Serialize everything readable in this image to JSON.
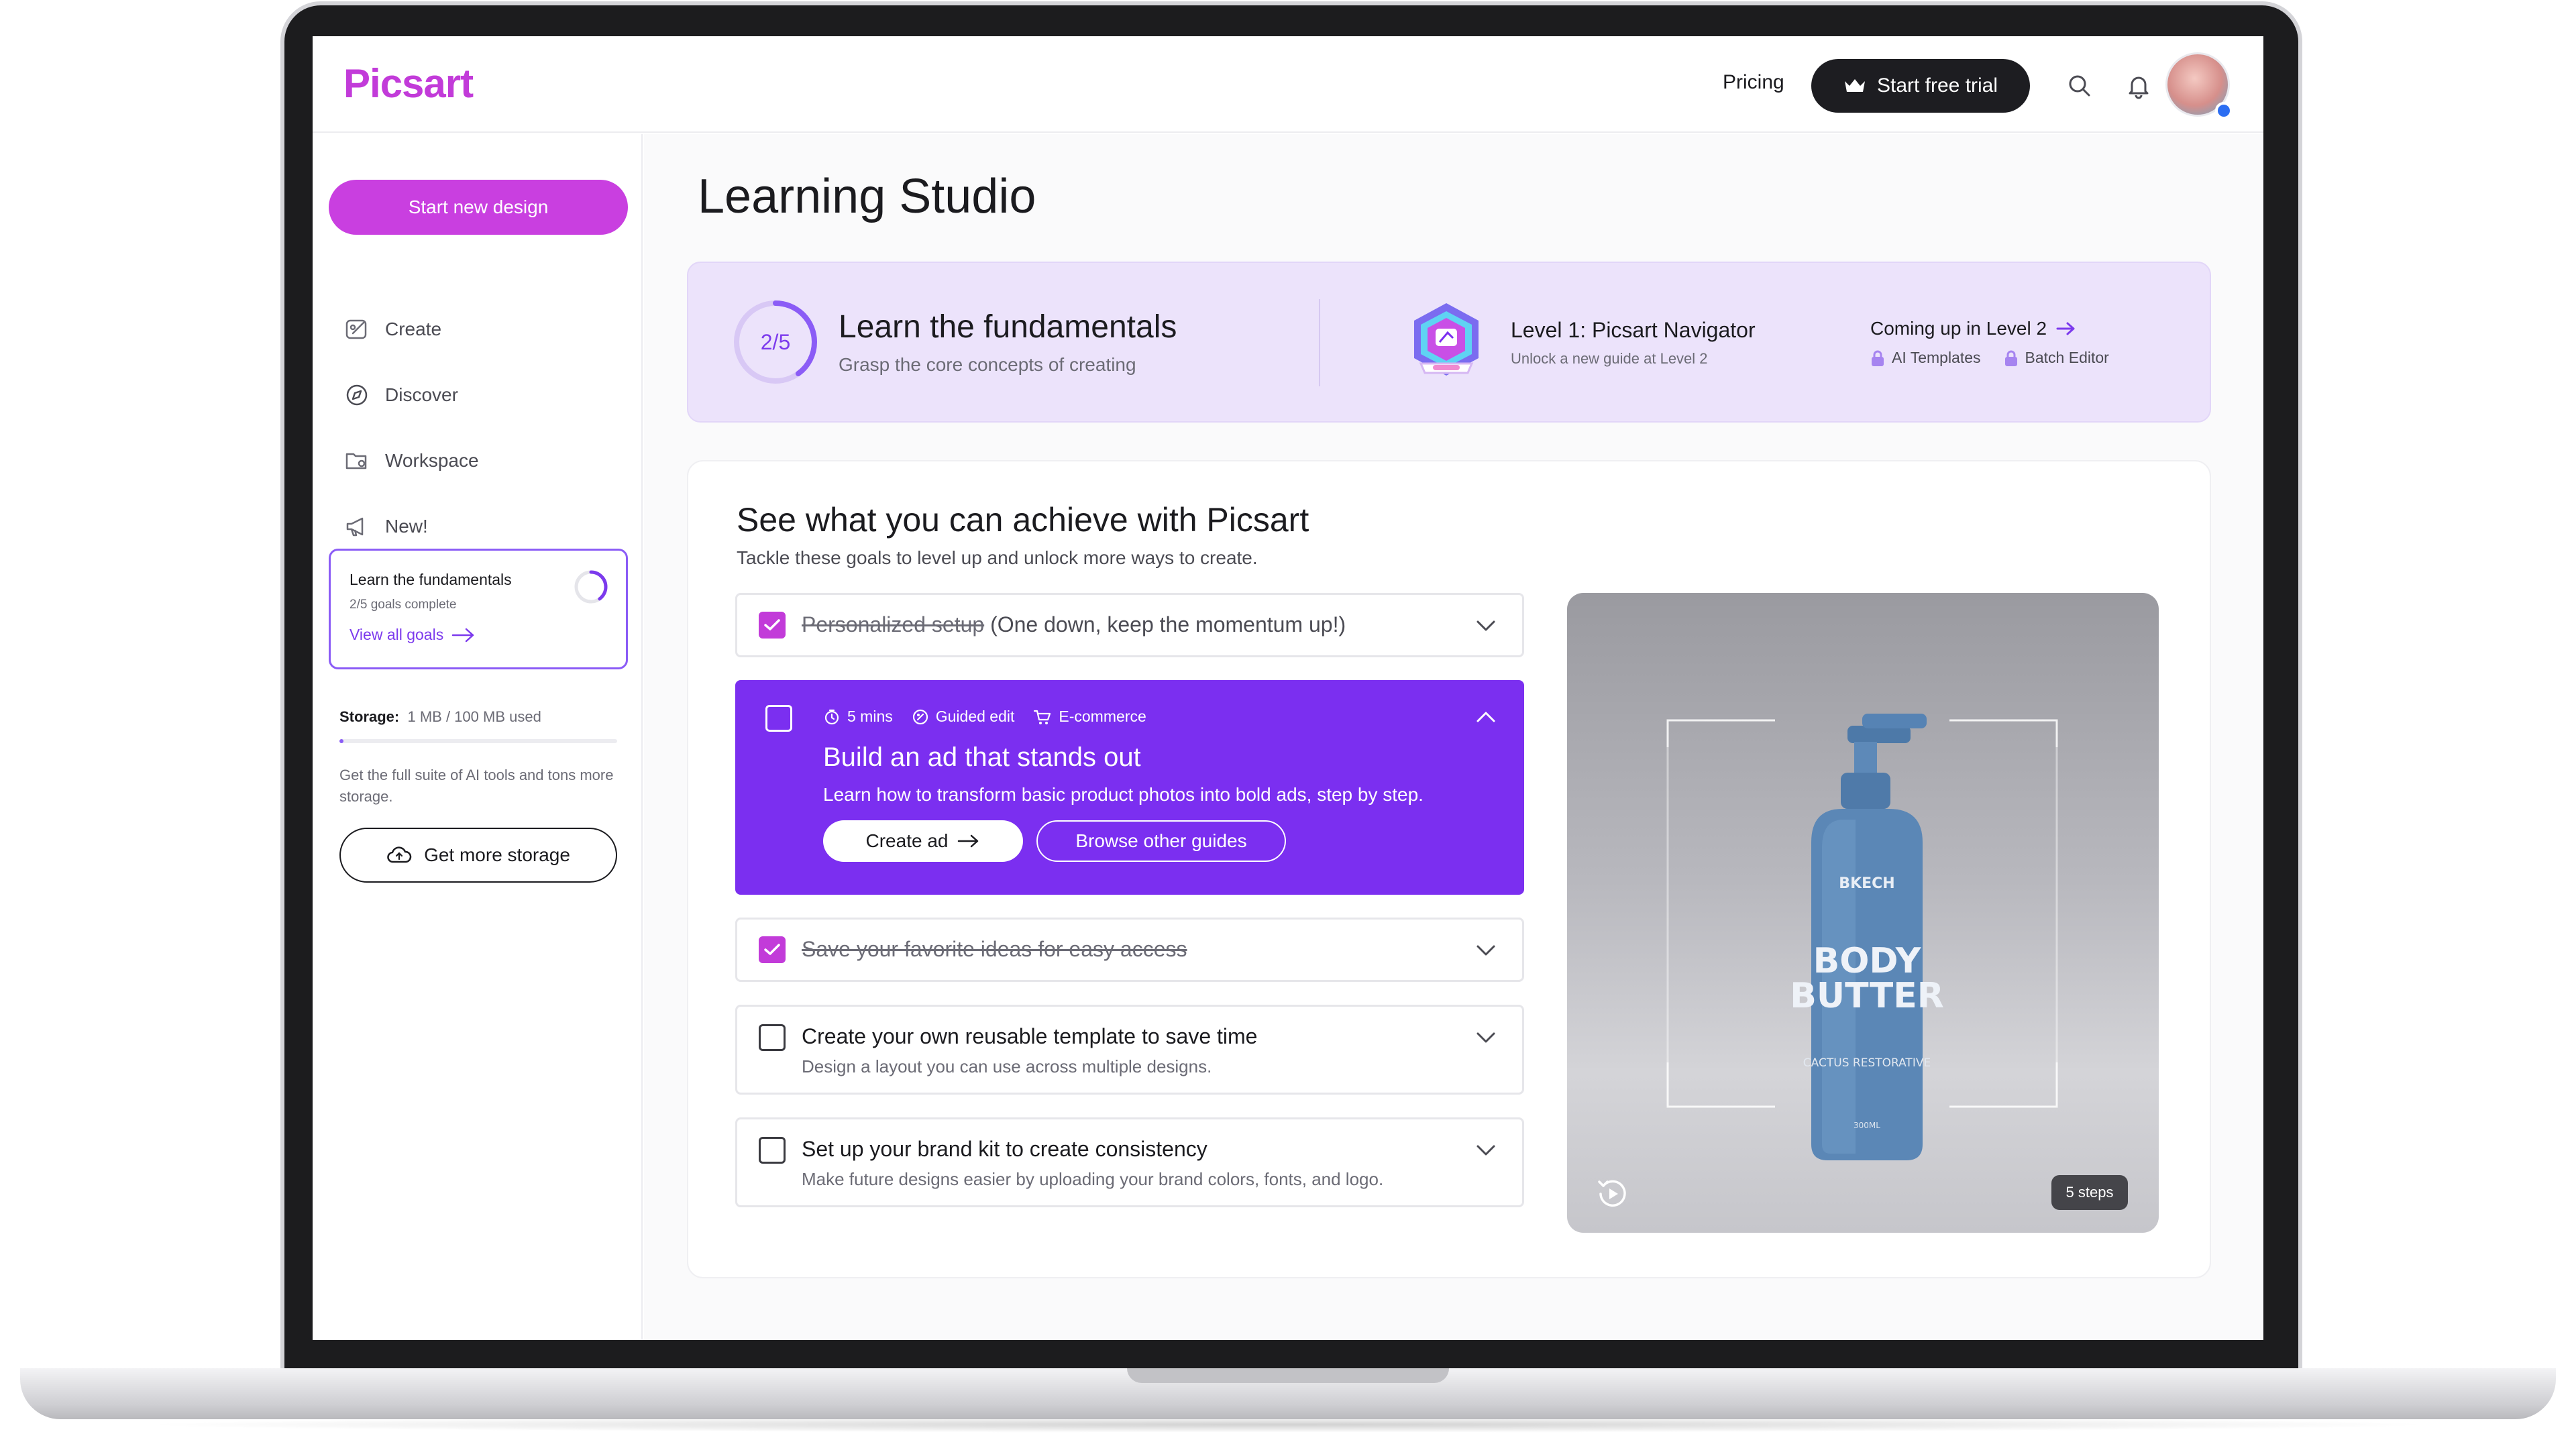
{
  "header": {
    "logo": "Picsart",
    "pricing": "Pricing",
    "trial_button": "Start free trial"
  },
  "sidebar": {
    "new_design": "Start new design",
    "items": [
      {
        "label": "Create",
        "icon": "create-icon"
      },
      {
        "label": "Discover",
        "icon": "compass-icon"
      },
      {
        "label": "Workspace",
        "icon": "workspace-icon"
      },
      {
        "label": "New!",
        "icon": "megaphone-icon"
      }
    ],
    "goal_card": {
      "title": "Learn the fundamentals",
      "progress": "2/5 goals complete",
      "link": "View all goals",
      "completed": 2,
      "total": 5
    },
    "storage": {
      "label": "Storage:",
      "used": "1 MB / 100 MB used",
      "used_fraction": 0.01,
      "description": "Get the full suite of AI tools and tons more storage.",
      "button": "Get more storage"
    }
  },
  "main": {
    "title": "Learning Studio",
    "banner": {
      "progress": "2/5",
      "progress_fraction": 0.4,
      "title": "Learn the fundamentals",
      "subtitle": "Grasp the core concepts of creating",
      "level_title": "Level 1: Picsart Navigator",
      "level_sub": "Unlock a new guide at Level 2",
      "next_title": "Coming up in Level 2",
      "next_items": [
        "AI Templates",
        "Batch Editor"
      ]
    },
    "panel": {
      "title": "See what you can achieve with Picsart",
      "subtitle": "Tackle these goals to level up and unlock more ways to create.",
      "tasks": [
        {
          "title": "Personalized setup",
          "note": "(One down, keep the momentum up!)",
          "done": true
        },
        {
          "title": "Build an ad that stands out",
          "desc": "Learn how to transform basic product photos into bold ads, step by step.",
          "tags": [
            "5 mins",
            "Guided edit",
            "E-commerce"
          ],
          "primary": "Create ad",
          "secondary": "Browse other guides",
          "done": false
        },
        {
          "title": "Save your favorite ideas for easy access",
          "done": true
        },
        {
          "title": "Create your own reusable template to save time",
          "desc": "Design a layout you can use across multiple designs.",
          "done": false
        },
        {
          "title": "Set up your brand kit to create consistency",
          "desc": "Make future designs easier by uploading your brand colors, fonts, and logo.",
          "done": false
        }
      ],
      "media": {
        "brand": "BKECH",
        "product_line1": "BODY",
        "product_line2": "BUTTER",
        "variant": "CACTUS RESTORATIVE",
        "volume": "300ML",
        "steps": "5 steps"
      }
    }
  },
  "colors": {
    "brand": "#c23bd9",
    "accent": "#7b2ff0",
    "banner_bg": "#ece3fb"
  }
}
